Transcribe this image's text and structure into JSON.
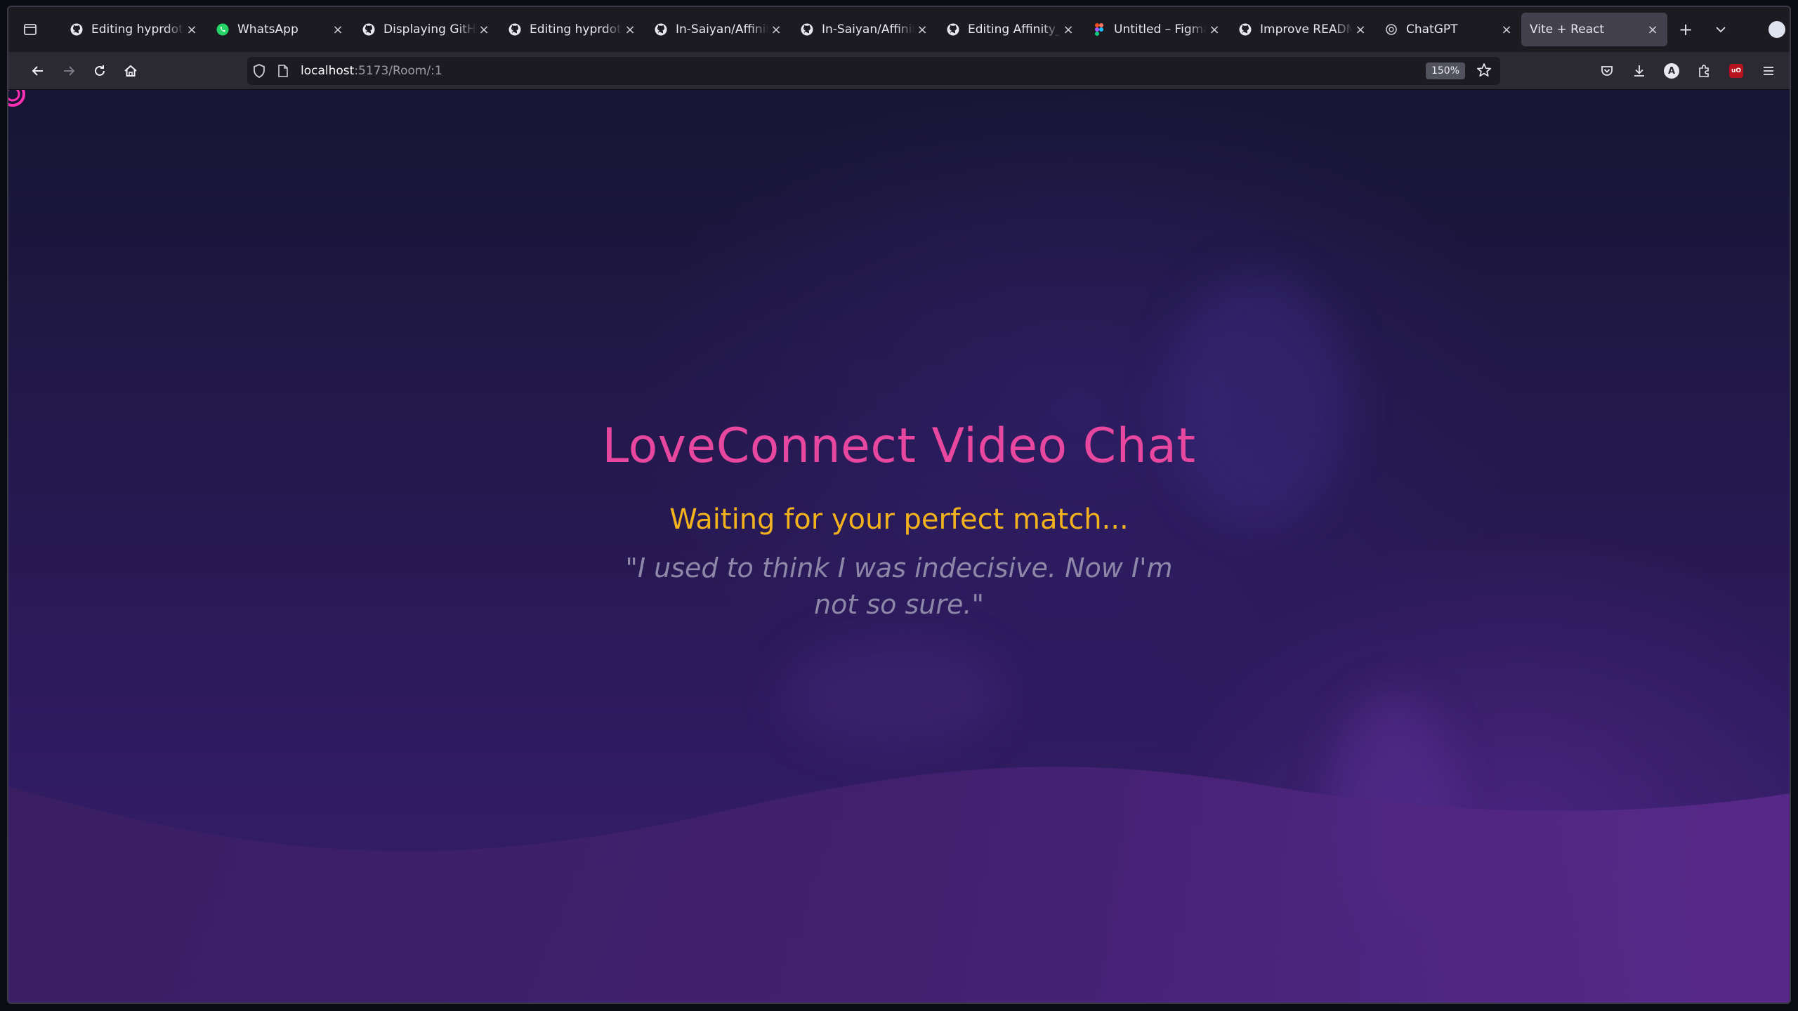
{
  "browser": {
    "tabs": [
      {
        "label": "Editing hyprdots/README",
        "icon": "github-icon",
        "active": false
      },
      {
        "label": "WhatsApp",
        "icon": "whatsapp-icon",
        "active": false
      },
      {
        "label": "Displaying GitHub",
        "icon": "github-icon",
        "active": false
      },
      {
        "label": "Editing hyprdots/README",
        "icon": "github-icon",
        "active": false
      },
      {
        "label": "In-Saiyan/Affinity_",
        "icon": "github-icon",
        "active": false
      },
      {
        "label": "In-Saiyan/Affinity_",
        "icon": "github-icon",
        "active": false
      },
      {
        "label": "Editing Affinity_fr",
        "icon": "github-icon",
        "active": false
      },
      {
        "label": "Untitled – Figma",
        "icon": "figma-icon",
        "active": false
      },
      {
        "label": "Improve README",
        "icon": "github-icon",
        "active": false
      },
      {
        "label": "ChatGPT",
        "icon": "openai-icon",
        "active": false
      },
      {
        "label": "Vite + React",
        "icon": "none",
        "active": true
      }
    ],
    "url": {
      "host": "localhost",
      "path": ":5173/Room/:1"
    },
    "zoom": "150%",
    "close_glyph": "×",
    "new_tab_glyph": "+",
    "avatar_letter": "A",
    "ublock_label": "uO"
  },
  "page": {
    "title": "LoveConnect Video Chat",
    "status": "Waiting for your perfect match...",
    "quote": "\"I used to think I was indecisive. Now I'm not so sure.\""
  },
  "colors": {
    "title": "#e8479f",
    "status": "#f2b21e",
    "quote": "#8d87a8",
    "background_top": "#171533",
    "background_bottom": "#38206e"
  }
}
